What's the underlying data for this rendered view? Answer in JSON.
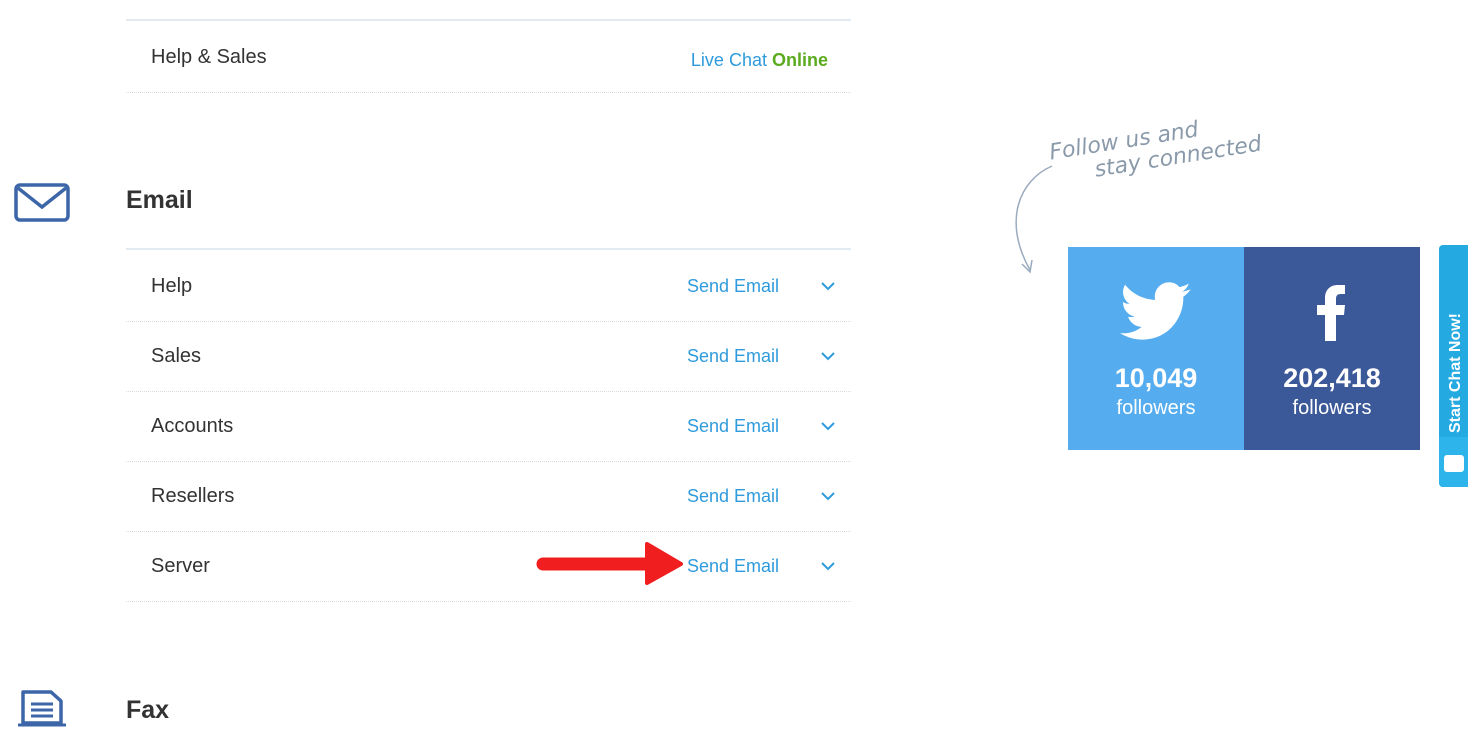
{
  "contact": {
    "help_sales_label": "Help & Sales",
    "live_chat_label": "Live Chat",
    "online_label": "Online"
  },
  "email": {
    "title": "Email",
    "rows": [
      {
        "label": "Help",
        "action": "Send Email"
      },
      {
        "label": "Sales",
        "action": "Send Email"
      },
      {
        "label": "Accounts",
        "action": "Send Email"
      },
      {
        "label": "Resellers",
        "action": "Send Email"
      },
      {
        "label": "Server",
        "action": "Send Email"
      }
    ]
  },
  "fax": {
    "title": "Fax"
  },
  "social": {
    "tagline_line1": "Follow us and",
    "tagline_line2": "stay connected",
    "twitter": {
      "count": "10,049",
      "label": "followers",
      "color": "#55acee"
    },
    "facebook": {
      "count": "202,418",
      "label": "followers",
      "color": "#3b5998"
    }
  },
  "chat_tab": {
    "label": "Start Chat Now!"
  },
  "annotation": {
    "arrow_color": "#f01e1e"
  },
  "colors": {
    "link": "#2f9bdc",
    "online": "#5bab1e",
    "icon": "#3d66a8"
  }
}
